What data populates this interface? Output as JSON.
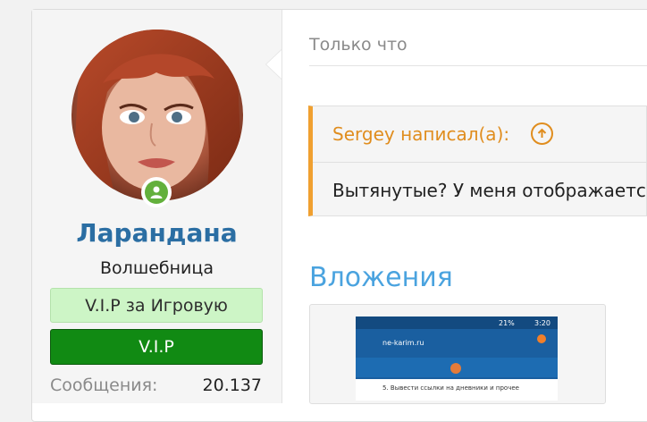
{
  "user": {
    "name": "Ларандана",
    "title": "Волшебница",
    "banners": [
      "V.I.P за Игровую",
      "V.I.P"
    ],
    "stat_label": "Сообщения:",
    "stat_value": "20.137",
    "status_color": "#63b03c",
    "name_color": "#2b6ea3"
  },
  "post": {
    "date": "Только что",
    "quote_author": "Sergey написал(а):",
    "quote_text": "Вытянутые? У меня отображается",
    "attachments_title": "Вложения"
  },
  "thumbnail": {
    "status_bar": "21%",
    "time": "3:20",
    "site": "ne-karim.ru",
    "line": "5. Вывести ссылки на дневники и прочее"
  },
  "colors": {
    "quote_accent": "#f0a030",
    "quote_author": "#e08d1e",
    "attach_title": "#4aa3df",
    "vip_green": "#118a13",
    "vip_light": "#cdf5c6"
  },
  "icons": {
    "online": "user-icon",
    "quote_link": "arrow-up-circle-icon"
  }
}
